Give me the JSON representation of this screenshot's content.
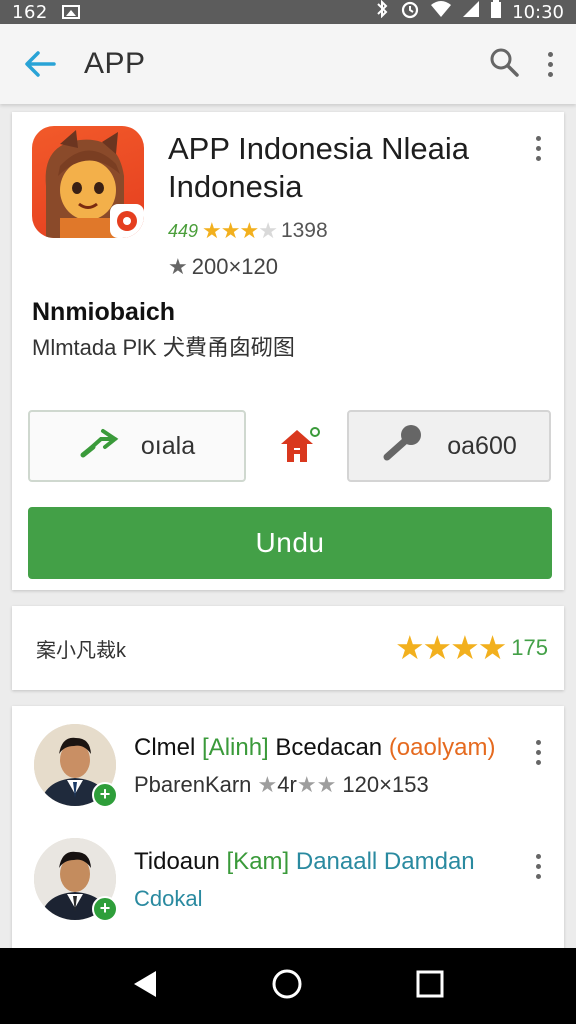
{
  "status_bar": {
    "time_left": "162",
    "clock": "10:30"
  },
  "app_bar": {
    "title": "APP",
    "back_icon": "arrow-left-icon",
    "search_icon": "search-icon",
    "menu_icon": "more-vert-icon"
  },
  "app": {
    "title": "APP Indonesia Nleaia Indonesia",
    "rating_value": "449",
    "rating_count": "1398",
    "size_text": "200×120",
    "developer": "Nnmiobaich",
    "developer_sub": "Mlmtada PlK 犬費甬囱砌图"
  },
  "actions": {
    "left_label": "oıala",
    "right_label": "oa600",
    "install_label": "Undu"
  },
  "rating_card": {
    "label": "案小凡裁k",
    "value": "175"
  },
  "reviews": [
    {
      "name": "Clmel",
      "tag": "[Alinh]",
      "extra": "Bcedacan",
      "tag2": "(oaolyam)",
      "sub": "PbarenKarn",
      "sub_rating": "4r",
      "sub_size": "120×153"
    },
    {
      "name": "Tidoaun",
      "tag": "[Kam]",
      "extra": "Danaall Damdan",
      "sub": "Cdokal"
    }
  ],
  "colors": {
    "accent": "#43a047",
    "back_arrow": "#29a3d6",
    "star": "#f2b01e",
    "app_icon": "#f25a2a"
  }
}
